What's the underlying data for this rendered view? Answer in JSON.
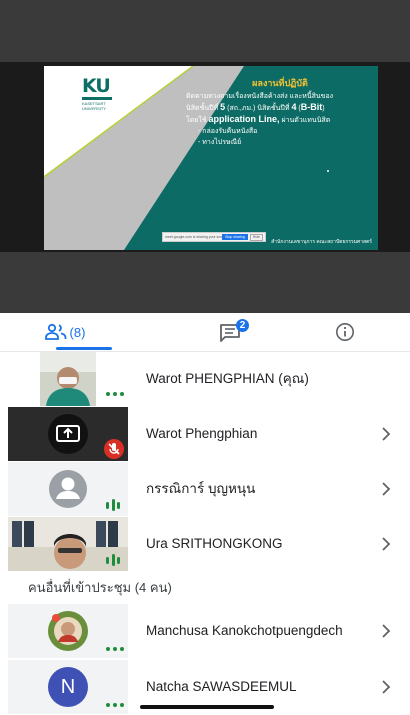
{
  "slide": {
    "logo_text": "KU",
    "logo_sub_1": "KASETSART",
    "logo_sub_2": "UNIVERSITY",
    "title": "ผลงานที่ปฏิบัติ",
    "line1": "ติดตามทวงถามเรื่องหนังสือค้างส่ง และหนี้สินของ",
    "line2a": "นิสิตชั้นปีที่ ",
    "line2b": "5",
    "line2c": " (สถ.,ภม.) นิสิตชั้นปีที่ ",
    "line2d": "4",
    "line2e": " (",
    "line2f": "B-Bit",
    "line2g": ")",
    "line3a": "โดยใช้ ",
    "line3b": "application Line,",
    "line3c": " ผ่านตัวแทนนิสิต",
    "bullet1": "- กล่องรับคืนหนังสือ",
    "bullet2": "- ทางไปรษณีย์",
    "share_text": "meet.google.com is sharing your screen.",
    "share_stop": "Stop sharing",
    "share_hide": "Hide",
    "footer": "สำนักงานเลขานุการ คณะสถาปัตยกรรมศาสตร์",
    "colors": {
      "teal": "#0c6b64",
      "green": "#b3d334",
      "gray": "#bfbfbf",
      "title": "#f2c233"
    }
  },
  "tabs": {
    "people_icon": "people-icon",
    "people_count": "(8)",
    "chat_icon": "chat-icon",
    "chat_badge": "2",
    "info_icon": "info-icon",
    "accent": "#1a73e8"
  },
  "participants": [
    {
      "name": "Warot PHENGPHIAN (คุณ)",
      "tile": "camera-video",
      "indicator": "more-dots"
    },
    {
      "name": "Warot Phengphian",
      "tile": "screen-share",
      "indicator": "muted-mic"
    },
    {
      "name": "กรรณิการ์ บุญหนุน",
      "tile": "default-avatar",
      "indicator": "speaking"
    },
    {
      "name": "Ura SRITHONGKONG",
      "tile": "camera-video",
      "indicator": "speaking"
    }
  ],
  "others_label": "คนอื่นที่เข้าประชุม (4 คน)",
  "others": [
    {
      "name": "Manchusa Kanokchotpuengdech",
      "tile": "photo-avatar",
      "indicator": "more-dots"
    },
    {
      "name": "Natcha SAWASDEEMUL",
      "tile": "letter-avatar",
      "avatar_letter": "N",
      "avatar_color": "#3f51b5",
      "indicator": "more-dots"
    }
  ]
}
